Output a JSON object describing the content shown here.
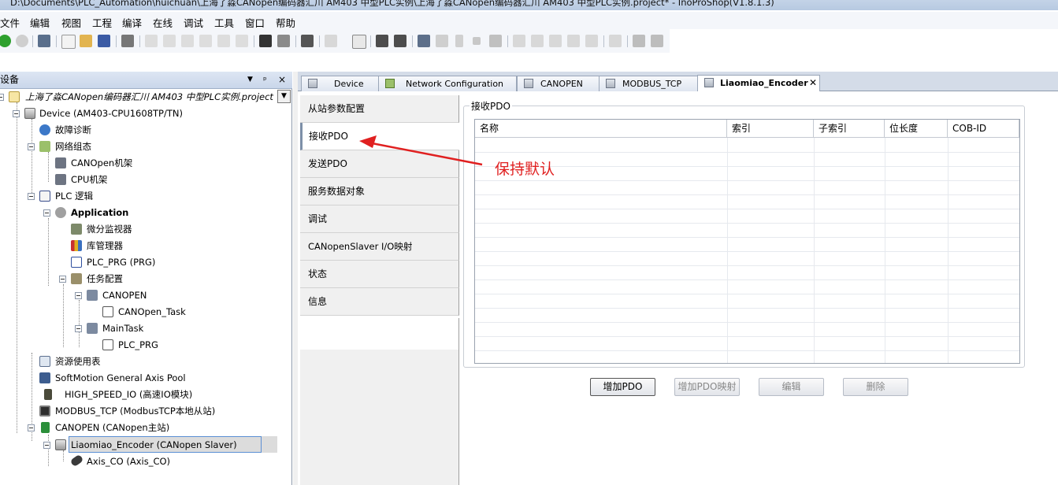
{
  "window": {
    "title": "D:\\Documents\\PLC_Automation\\huichuan\\上海了淼CANopen编码器汇川 AM403 中型PLC实例\\上海了淼CANopen编码器汇川 AM403 中型PLC实例.project* - InoProShop(V1.8.1.3)"
  },
  "menu": [
    "文件",
    "编辑",
    "视图",
    "工程",
    "编译",
    "在线",
    "调试",
    "工具",
    "窗口",
    "帮助"
  ],
  "devices_panel": {
    "title": "设备",
    "pin": "▼ ᵖ ×",
    "tree": [
      {
        "label": "上海了淼CANopen编码器汇川 AM403 中型PLC实例.project",
        "italic": true
      },
      {
        "label": "Device (AM403-CPU1608TP/TN)"
      },
      {
        "label": "故障诊断"
      },
      {
        "label": "网络组态"
      },
      {
        "label": "CANOpen机架"
      },
      {
        "label": "CPU机架"
      },
      {
        "label": "PLC 逻辑"
      },
      {
        "label": "Application",
        "bold": true
      },
      {
        "label": "微分监视器"
      },
      {
        "label": "库管理器"
      },
      {
        "label": "PLC_PRG (PRG)"
      },
      {
        "label": "任务配置"
      },
      {
        "label": "CANOPEN"
      },
      {
        "label": "CANOpen_Task"
      },
      {
        "label": "MainTask"
      },
      {
        "label": "PLC_PRG"
      },
      {
        "label": "资源使用表"
      },
      {
        "label": "SoftMotion General Axis Pool"
      },
      {
        "label": "HIGH_SPEED_IO (高速IO模块)"
      },
      {
        "label": "MODBUS_TCP (ModbusTCP本地从站)"
      },
      {
        "label": "CANOPEN (CANopen主站)"
      },
      {
        "label": "Liaomiao_Encoder (CANopen Slaver)",
        "selected": true
      },
      {
        "label": "Axis_CO (Axis_CO)"
      }
    ]
  },
  "tabs": [
    {
      "label": "Device"
    },
    {
      "label": "Network Configuration"
    },
    {
      "label": "CANOPEN"
    },
    {
      "label": "MODBUS_TCP"
    },
    {
      "label": "Liaomiao_Encoder",
      "active": true,
      "close": "✕"
    }
  ],
  "side_nav": [
    {
      "label": "从站参数配置"
    },
    {
      "label": "接收PDO",
      "selected": true
    },
    {
      "label": "发送PDO"
    },
    {
      "label": "服务数据对象"
    },
    {
      "label": "调试"
    },
    {
      "label": "CANopenSlaver I/O映射"
    },
    {
      "label": "状态"
    },
    {
      "label": "信息"
    }
  ],
  "pdo_group": {
    "title": "接收PDO",
    "columns": [
      "名称",
      "索引",
      "子索引",
      "位长度",
      "COB-ID"
    ]
  },
  "buttons": {
    "add_pdo": "增加PDO",
    "add_mapping": "增加PDO映射",
    "edit": "编辑",
    "delete": "删除"
  },
  "annotation": {
    "text": "保持默认",
    "color": "#e02020"
  }
}
